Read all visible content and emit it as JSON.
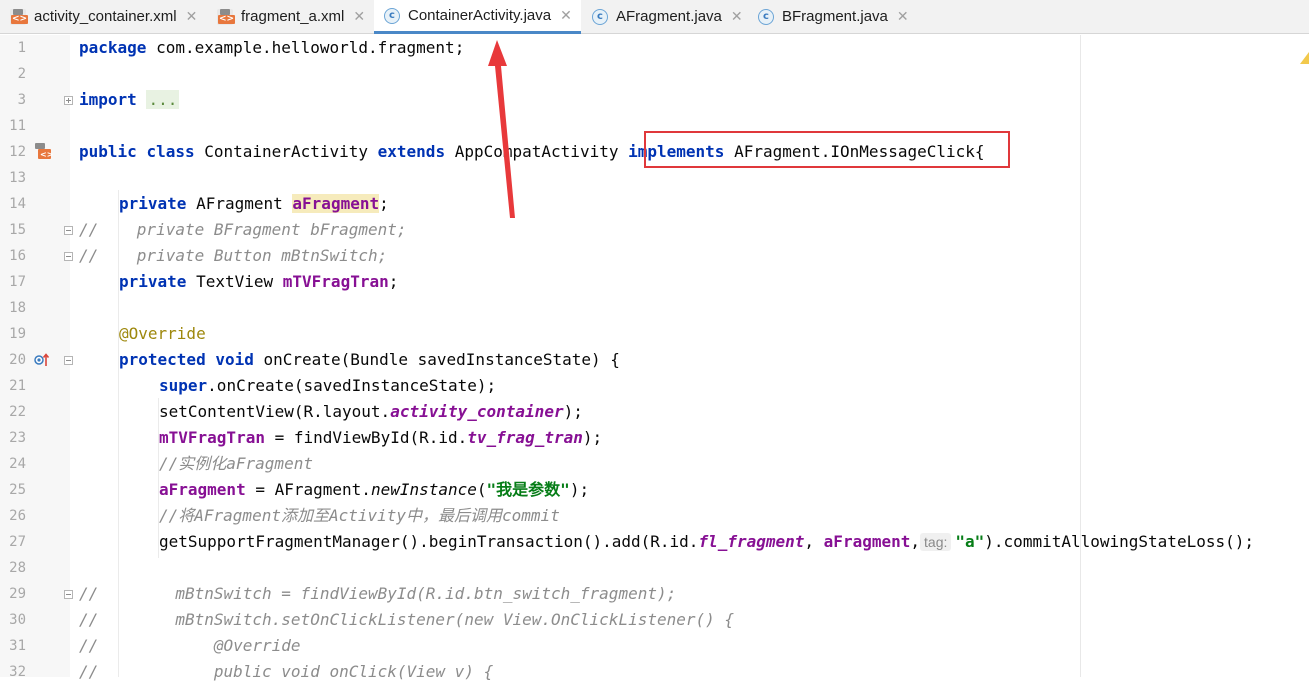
{
  "tabs": [
    {
      "label": "activity_container.xml",
      "icon": "xml-file-icon",
      "active": false
    },
    {
      "label": "fragment_a.xml",
      "icon": "xml-file-icon",
      "active": false
    },
    {
      "label": "ContainerActivity.java",
      "icon": "java-class-icon",
      "active": true
    },
    {
      "label": "AFragment.java",
      "icon": "java-class-icon",
      "active": false
    },
    {
      "label": "BFragment.java",
      "icon": "java-class-icon",
      "active": false
    }
  ],
  "close_glyph": "✕",
  "class_glyph": "c",
  "line_numbers": [
    "1",
    "2",
    "3",
    "11",
    "12",
    "13",
    "14",
    "15",
    "16",
    "17",
    "18",
    "19",
    "20",
    "21",
    "22",
    "23",
    "24",
    "25",
    "26",
    "27",
    "28",
    "29",
    "30",
    "31",
    "32"
  ],
  "code": {
    "l1": {
      "kw": "package",
      "rest": " com.example.helloworld.fragment;"
    },
    "l3": {
      "kw": "import",
      "folded": "..."
    },
    "l12": {
      "kw1": "public",
      "kw2": "class",
      "name": " ContainerActivity ",
      "kw3": "extends",
      "base": " AppCompatActivity ",
      "kw4": "implements",
      "iface": " AFragment.IOnMessageClick{"
    },
    "l14": {
      "kw": "private",
      "type": " AFragment ",
      "field": "aFragment",
      "end": ";"
    },
    "l15": "//    private BFragment bFragment;",
    "l16": "//    private Button mBtnSwitch;",
    "l17": {
      "kw": "private",
      "type": " TextView ",
      "field": "mTVFragTran",
      "end": ";"
    },
    "l19": "@Override",
    "l20": {
      "kw1": "protected",
      "kw2": "void",
      "rest": " onCreate(Bundle savedInstanceState) {"
    },
    "l21": {
      "kw": "super",
      "rest": ".onCreate(savedInstanceState);"
    },
    "l22": {
      "pre": "setContentView(R.layout.",
      "it": "activity_container",
      "post": ");"
    },
    "l23": {
      "field": "mTVFragTran",
      "pre": " = findViewById(R.id.",
      "it": "tv_frag_tran",
      "post": ");"
    },
    "l24": "//实例化aFragment",
    "l25": {
      "field": "aFragment",
      "pre": " = AFragment.",
      "mi": "newInstance",
      "open": "(",
      "str": "\"我是参数\"",
      "post": ");"
    },
    "l26": "//将AFragment添加至Activity中，最后调用commit",
    "l27": {
      "pre": "getSupportFragmentManager().beginTransaction().add(R.id.",
      "it": "fl_fragment",
      "mid": ", ",
      "field": "aFragment",
      "comma": ",",
      "hint": "tag:",
      "str": "\"a\"",
      "post": ").commitAllowingStateLoss();"
    },
    "l29": "//        mBtnSwitch = findViewById(R.id.btn_switch_fragment);",
    "l30": "//        mBtnSwitch.setOnClickListener(new View.OnClickListener() {",
    "l31": "//            @Override",
    "l32": "//            public void onClick(View v) {"
  }
}
